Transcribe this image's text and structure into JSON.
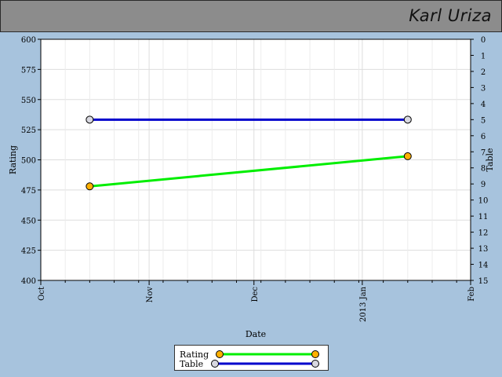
{
  "header": {
    "player_name": "Karl Uriza",
    "background": "#8c8c8c"
  },
  "colors": {
    "page_background": "#a7c3dd",
    "plot_background": "#ffffff",
    "grid": "#dddddd",
    "rating_line": "#00ee00",
    "rating_marker": "#ffb000",
    "table_line": "#0000cc",
    "table_marker": "#d8d8e0"
  },
  "chart_data": {
    "type": "line",
    "xlabel": "Date",
    "x_ticks": [
      {
        "date": "2012-10-01",
        "label": "Oct"
      },
      {
        "date": "2012-11-01",
        "label": "Nov"
      },
      {
        "date": "2012-12-01",
        "label": "Dec"
      },
      {
        "date": "2013-01-01",
        "label": "2013 Jan"
      },
      {
        "date": "2013-02-01",
        "label": "Feb"
      }
    ],
    "xlim": [
      "2012-10-01",
      "2013-02-01"
    ],
    "y_left": {
      "label": "Rating",
      "ylim": [
        400,
        600
      ],
      "ticks": [
        400,
        425,
        450,
        475,
        500,
        525,
        550,
        575,
        600
      ]
    },
    "y_right": {
      "label": "Table",
      "ylim": [
        0,
        15
      ],
      "inverted": true,
      "ticks": [
        0,
        1,
        2,
        3,
        4,
        5,
        6,
        7,
        8,
        9,
        10,
        11,
        12,
        13,
        14,
        15
      ]
    },
    "grid": true,
    "legend_position": "bottom-center",
    "series": [
      {
        "name": "Rating",
        "axis": "left",
        "color": "#00ee00",
        "marker_color": "#ffb000",
        "points": [
          {
            "x": "2012-10-15",
            "y": 478
          },
          {
            "x": "2013-01-14",
            "y": 503
          }
        ]
      },
      {
        "name": "Table",
        "axis": "right",
        "color": "#0000cc",
        "marker_color": "#d8d8e0",
        "points": [
          {
            "x": "2012-10-15",
            "y": 5
          },
          {
            "x": "2013-01-14",
            "y": 5
          }
        ]
      }
    ]
  }
}
